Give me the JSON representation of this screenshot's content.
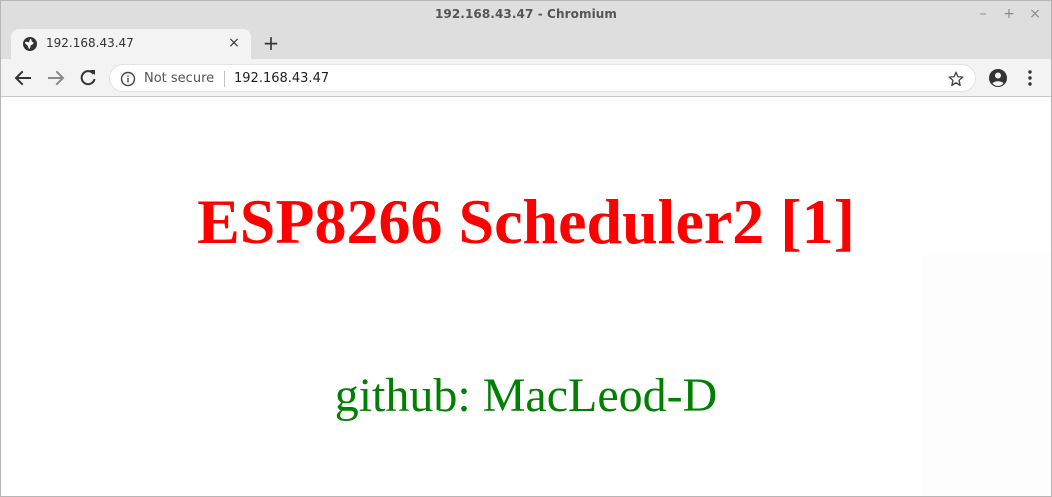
{
  "window": {
    "title": "192.168.43.47 - Chromium",
    "minimize_label": "–",
    "maximize_label": "+",
    "close_label": "×"
  },
  "tab": {
    "title": "192.168.43.47",
    "favicon": "globe-icon",
    "close_label": "×",
    "new_tab_label": "+"
  },
  "toolbar": {
    "back_icon": "back-arrow-icon",
    "forward_icon": "forward-arrow-icon",
    "reload_icon": "reload-icon",
    "security_label": "Not secure",
    "url": "192.168.43.47",
    "bookmark_icon": "star-icon",
    "profile_icon": "account-icon",
    "menu_icon": "kebab-menu-icon"
  },
  "page": {
    "heading": "ESP8266 Scheduler2 [1]",
    "subheading": "github: MacLeod-D",
    "heading_color": "#ff0000",
    "subheading_color": "#008000"
  }
}
